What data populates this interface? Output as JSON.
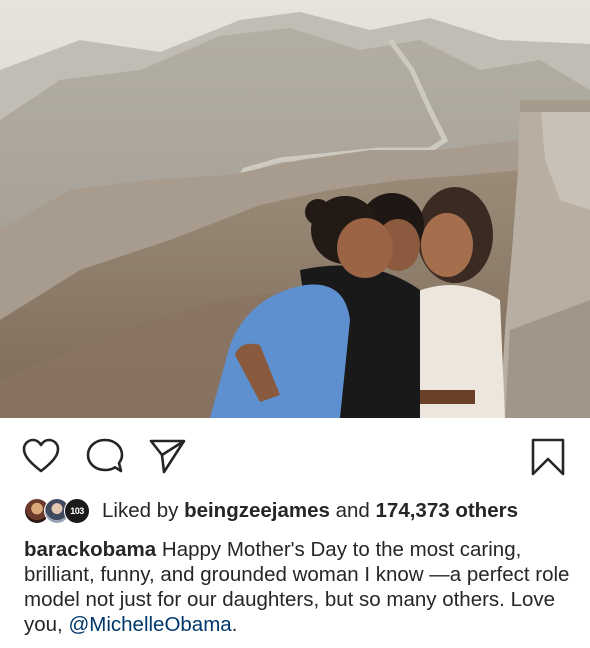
{
  "post": {
    "photo_alt": "Three women hugging on the Great Wall",
    "actions": [
      {
        "name": "like",
        "icon": "heart-outline-icon"
      },
      {
        "name": "comment",
        "icon": "comment-bubble-icon"
      },
      {
        "name": "share",
        "icon": "paper-plane-icon"
      },
      {
        "name": "save",
        "icon": "bookmark-outline-icon"
      }
    ],
    "likes": {
      "prefix": "Liked by",
      "user": "beingzeejames",
      "joiner": "and",
      "count": "174,373 others",
      "avatar_badge": "103"
    },
    "caption": {
      "username": "barackobama",
      "text": "Happy Mother's Day to the most caring, brilliant, funny, and grounded woman I know —a perfect role model not just for our daughters, but so many others. Love you, ",
      "mention": "@MichelleObama",
      "end": "."
    }
  },
  "colors": {
    "text": "#262626",
    "mention": "#00376b",
    "background": "#ffffff"
  }
}
